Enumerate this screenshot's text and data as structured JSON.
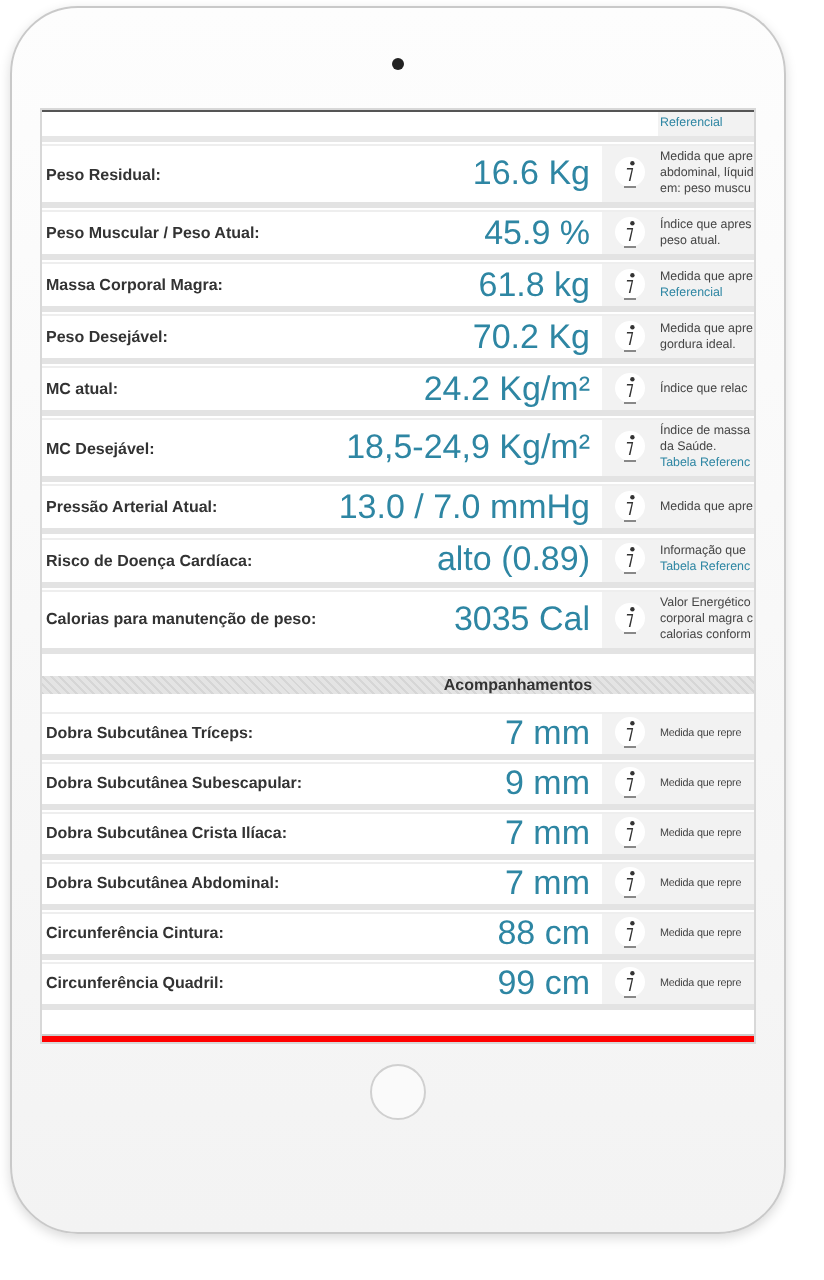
{
  "top_fragment": {
    "note": "Referencial"
  },
  "rows": [
    {
      "label": "Peso Residual:",
      "value": "16.6 Kg",
      "note": [
        {
          "kind": "text",
          "text": "Medida que apre"
        },
        {
          "kind": "text",
          "text": "abdominal, líquid"
        },
        {
          "kind": "text",
          "text": "em: peso muscu"
        }
      ]
    },
    {
      "label": "Peso Muscular / Peso Atual:",
      "value": "45.9 %",
      "note": [
        {
          "kind": "text",
          "text": "Índice que apres"
        },
        {
          "kind": "text",
          "text": "peso atual."
        }
      ]
    },
    {
      "label": "Massa Corporal Magra:",
      "value": "61.8 kg",
      "note": [
        {
          "kind": "text",
          "text": "Medida que apre"
        },
        {
          "kind": "link",
          "text": "Referencial"
        }
      ]
    },
    {
      "label": "Peso Desejável:",
      "value": "70.2 Kg",
      "note": [
        {
          "kind": "text",
          "text": "Medida que apre"
        },
        {
          "kind": "text",
          "text": "gordura ideal."
        }
      ]
    },
    {
      "label": "MC atual:",
      "value": "24.2 Kg/m²",
      "note": [
        {
          "kind": "text",
          "text": "Índice que relac"
        }
      ]
    },
    {
      "label": "MC Desejável:",
      "value": "18,5-24,9 Kg/m²",
      "note": [
        {
          "kind": "text",
          "text": "Índice de massa"
        },
        {
          "kind": "text",
          "text": "da Saúde."
        },
        {
          "kind": "link",
          "text": "Tabela Referenc"
        }
      ]
    },
    {
      "label": "Pressão Arterial Atual:",
      "value": "13.0 / 7.0 mmHg",
      "note": [
        {
          "kind": "text",
          "text": "Medida que apre"
        }
      ]
    },
    {
      "label": "Risco de Doença Cardíaca:",
      "value": "alto (0.89)",
      "note": [
        {
          "kind": "text",
          "text": "Informação que"
        },
        {
          "kind": "link",
          "text": "Tabela Referenc"
        }
      ]
    },
    {
      "label": "Calorias para manutenção de peso:",
      "value": "3035 Cal",
      "note": [
        {
          "kind": "text",
          "text": "Valor Energético"
        },
        {
          "kind": "text",
          "text": "corporal magra c"
        },
        {
          "kind": "text",
          "text": "calorias conform"
        }
      ]
    }
  ],
  "section_title": "Acompanhamentos",
  "tracking_rows": [
    {
      "label": "Dobra Subcutânea Tríceps:",
      "value": "7 mm",
      "note": "Medida que repre"
    },
    {
      "label": "Dobra Subcutânea Subescapular:",
      "value": "9 mm",
      "note": "Medida que repre"
    },
    {
      "label": "Dobra Subcutânea Crista Ilíaca:",
      "value": "7 mm",
      "note": "Medida que repre"
    },
    {
      "label": "Dobra Subcutânea Abdominal:",
      "value": "7 mm",
      "note": "Medida que repre"
    },
    {
      "label": "Circunferência Cintura:",
      "value": "88 cm",
      "note": "Medida que repre"
    },
    {
      "label": "Circunferência Quadril:",
      "value": "99 cm",
      "note": "Medida que repre"
    }
  ]
}
